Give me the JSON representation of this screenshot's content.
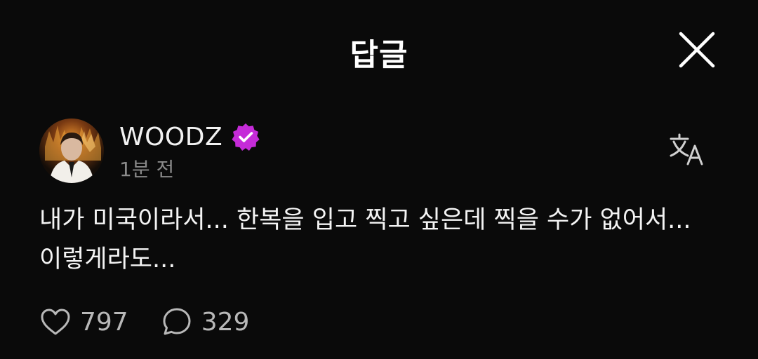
{
  "header": {
    "title": "답글",
    "close_icon": "close-icon"
  },
  "post": {
    "username": "WOODZ",
    "verified_icon": "verified-badge-icon",
    "verified_color": "#c52bd8",
    "timestamp": "1분 전",
    "translate_icon": "translate-icon",
    "text": "내가 미국이라서... 한복을 입고 찍고 싶은데 찍을 수가 없어서... 이렇게라도...",
    "likes": "797",
    "replies": "329",
    "like_icon": "heart-icon",
    "reply_icon": "comment-icon"
  },
  "colors": {
    "background": "#0a0a0a",
    "text": "#ffffff",
    "muted": "#8a8a8a"
  }
}
